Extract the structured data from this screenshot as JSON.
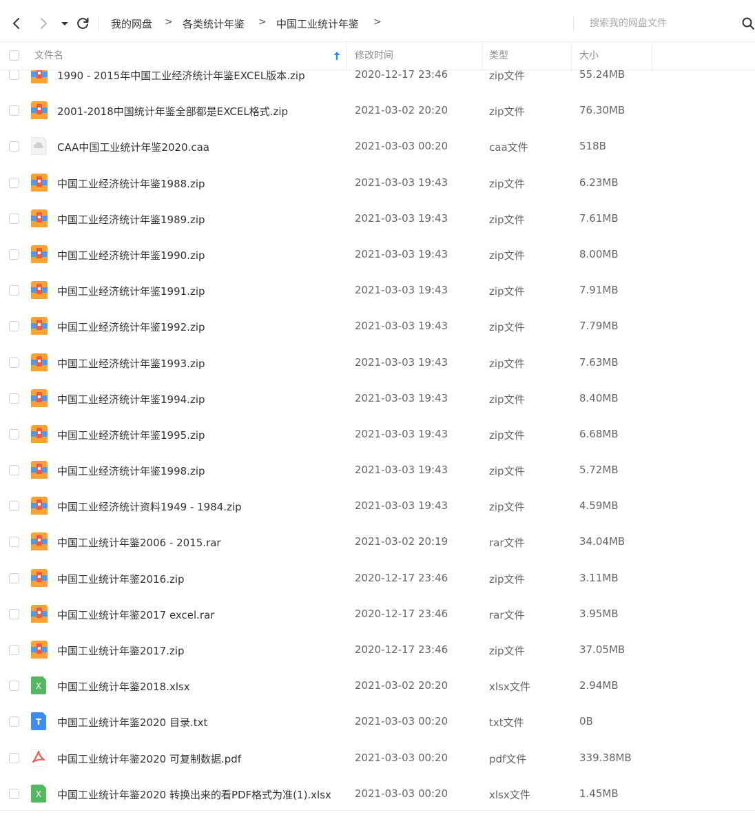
{
  "toolbar": {
    "breadcrumb": [
      {
        "label": "我的网盘"
      },
      {
        "label": "各类统计年鉴"
      },
      {
        "label": "中国工业统计年鉴"
      }
    ],
    "arrow_glyph": ">",
    "search_placeholder": "搜索我的网盘文件"
  },
  "table": {
    "columns": {
      "name": "文件名",
      "modified": "修改时间",
      "type": "类型",
      "size": "大小"
    },
    "sort": {
      "column": "name",
      "direction": "ascending"
    },
    "rows": [
      {
        "icon": "zip",
        "name": "1990 - 2015年中国工业经济统计年鉴EXCEL版本.zip",
        "modified": "2020-12-17 23:46",
        "type": "zip文件",
        "size": "55.24MB"
      },
      {
        "icon": "zip",
        "name": "2001-2018中国统计年鉴全部都是EXCEL格式.zip",
        "modified": "2021-03-02 20:20",
        "type": "zip文件",
        "size": "76.30MB"
      },
      {
        "icon": "caa",
        "name": "CAA中国工业统计年鉴2020.caa",
        "modified": "2021-03-03 00:20",
        "type": "caa文件",
        "size": "518B"
      },
      {
        "icon": "zip",
        "name": "中国工业经济统计年鉴1988.zip",
        "modified": "2021-03-03 19:43",
        "type": "zip文件",
        "size": "6.23MB"
      },
      {
        "icon": "zip",
        "name": "中国工业经济统计年鉴1989.zip",
        "modified": "2021-03-03 19:43",
        "type": "zip文件",
        "size": "7.61MB"
      },
      {
        "icon": "zip",
        "name": "中国工业经济统计年鉴1990.zip",
        "modified": "2021-03-03 19:43",
        "type": "zip文件",
        "size": "8.00MB"
      },
      {
        "icon": "zip",
        "name": "中国工业经济统计年鉴1991.zip",
        "modified": "2021-03-03 19:43",
        "type": "zip文件",
        "size": "7.91MB"
      },
      {
        "icon": "zip",
        "name": "中国工业经济统计年鉴1992.zip",
        "modified": "2021-03-03 19:43",
        "type": "zip文件",
        "size": "7.79MB"
      },
      {
        "icon": "zip",
        "name": "中国工业经济统计年鉴1993.zip",
        "modified": "2021-03-03 19:43",
        "type": "zip文件",
        "size": "7.63MB"
      },
      {
        "icon": "zip",
        "name": "中国工业经济统计年鉴1994.zip",
        "modified": "2021-03-03 19:43",
        "type": "zip文件",
        "size": "8.40MB"
      },
      {
        "icon": "zip",
        "name": "中国工业经济统计年鉴1995.zip",
        "modified": "2021-03-03 19:43",
        "type": "zip文件",
        "size": "6.68MB"
      },
      {
        "icon": "zip",
        "name": "中国工业经济统计年鉴1998.zip",
        "modified": "2021-03-03 19:43",
        "type": "zip文件",
        "size": "5.72MB"
      },
      {
        "icon": "zip",
        "name": "中国工业经济统计资料1949 - 1984.zip",
        "modified": "2021-03-03 19:43",
        "type": "zip文件",
        "size": "4.59MB"
      },
      {
        "icon": "zip",
        "name": "中国工业统计年鉴2006 - 2015.rar",
        "modified": "2021-03-02 20:19",
        "type": "rar文件",
        "size": "34.04MB"
      },
      {
        "icon": "zip",
        "name": "中国工业统计年鉴2016.zip",
        "modified": "2020-12-17 23:46",
        "type": "zip文件",
        "size": "3.11MB"
      },
      {
        "icon": "zip",
        "name": "中国工业统计年鉴2017 excel.rar",
        "modified": "2020-12-17 23:46",
        "type": "rar文件",
        "size": "3.95MB"
      },
      {
        "icon": "zip",
        "name": "中国工业统计年鉴2017.zip",
        "modified": "2020-12-17 23:46",
        "type": "zip文件",
        "size": "37.05MB"
      },
      {
        "icon": "xlsx",
        "name": "中国工业统计年鉴2018.xlsx",
        "modified": "2021-03-02 20:20",
        "type": "xlsx文件",
        "size": "2.94MB"
      },
      {
        "icon": "txt",
        "name": "中国工业统计年鉴2020  目录.txt",
        "modified": "2021-03-03 00:20",
        "type": "txt文件",
        "size": "0B"
      },
      {
        "icon": "pdf",
        "name": "中国工业统计年鉴2020 可复制数据.pdf",
        "modified": "2021-03-03 00:20",
        "type": "pdf文件",
        "size": "339.38MB"
      },
      {
        "icon": "xlsx",
        "name": "中国工业统计年鉴2020 转换出来的看PDF格式为准(1).xlsx",
        "modified": "2021-03-03 00:20",
        "type": "xlsx文件",
        "size": "1.45MB"
      }
    ]
  },
  "icon_glyphs": {
    "txt": "T",
    "xlsx": "X"
  },
  "colors": {
    "zip_orange": "#f7a233",
    "zip_blue": "#4c9bf0",
    "zip_red": "#ef5a47",
    "xlsx_green": "#53b85f",
    "txt_blue": "#3f8cf0",
    "pdf_red": "#ef5a4f",
    "caa_gray": "#cfcfcf",
    "sort_blue": "#2d8cf0"
  }
}
